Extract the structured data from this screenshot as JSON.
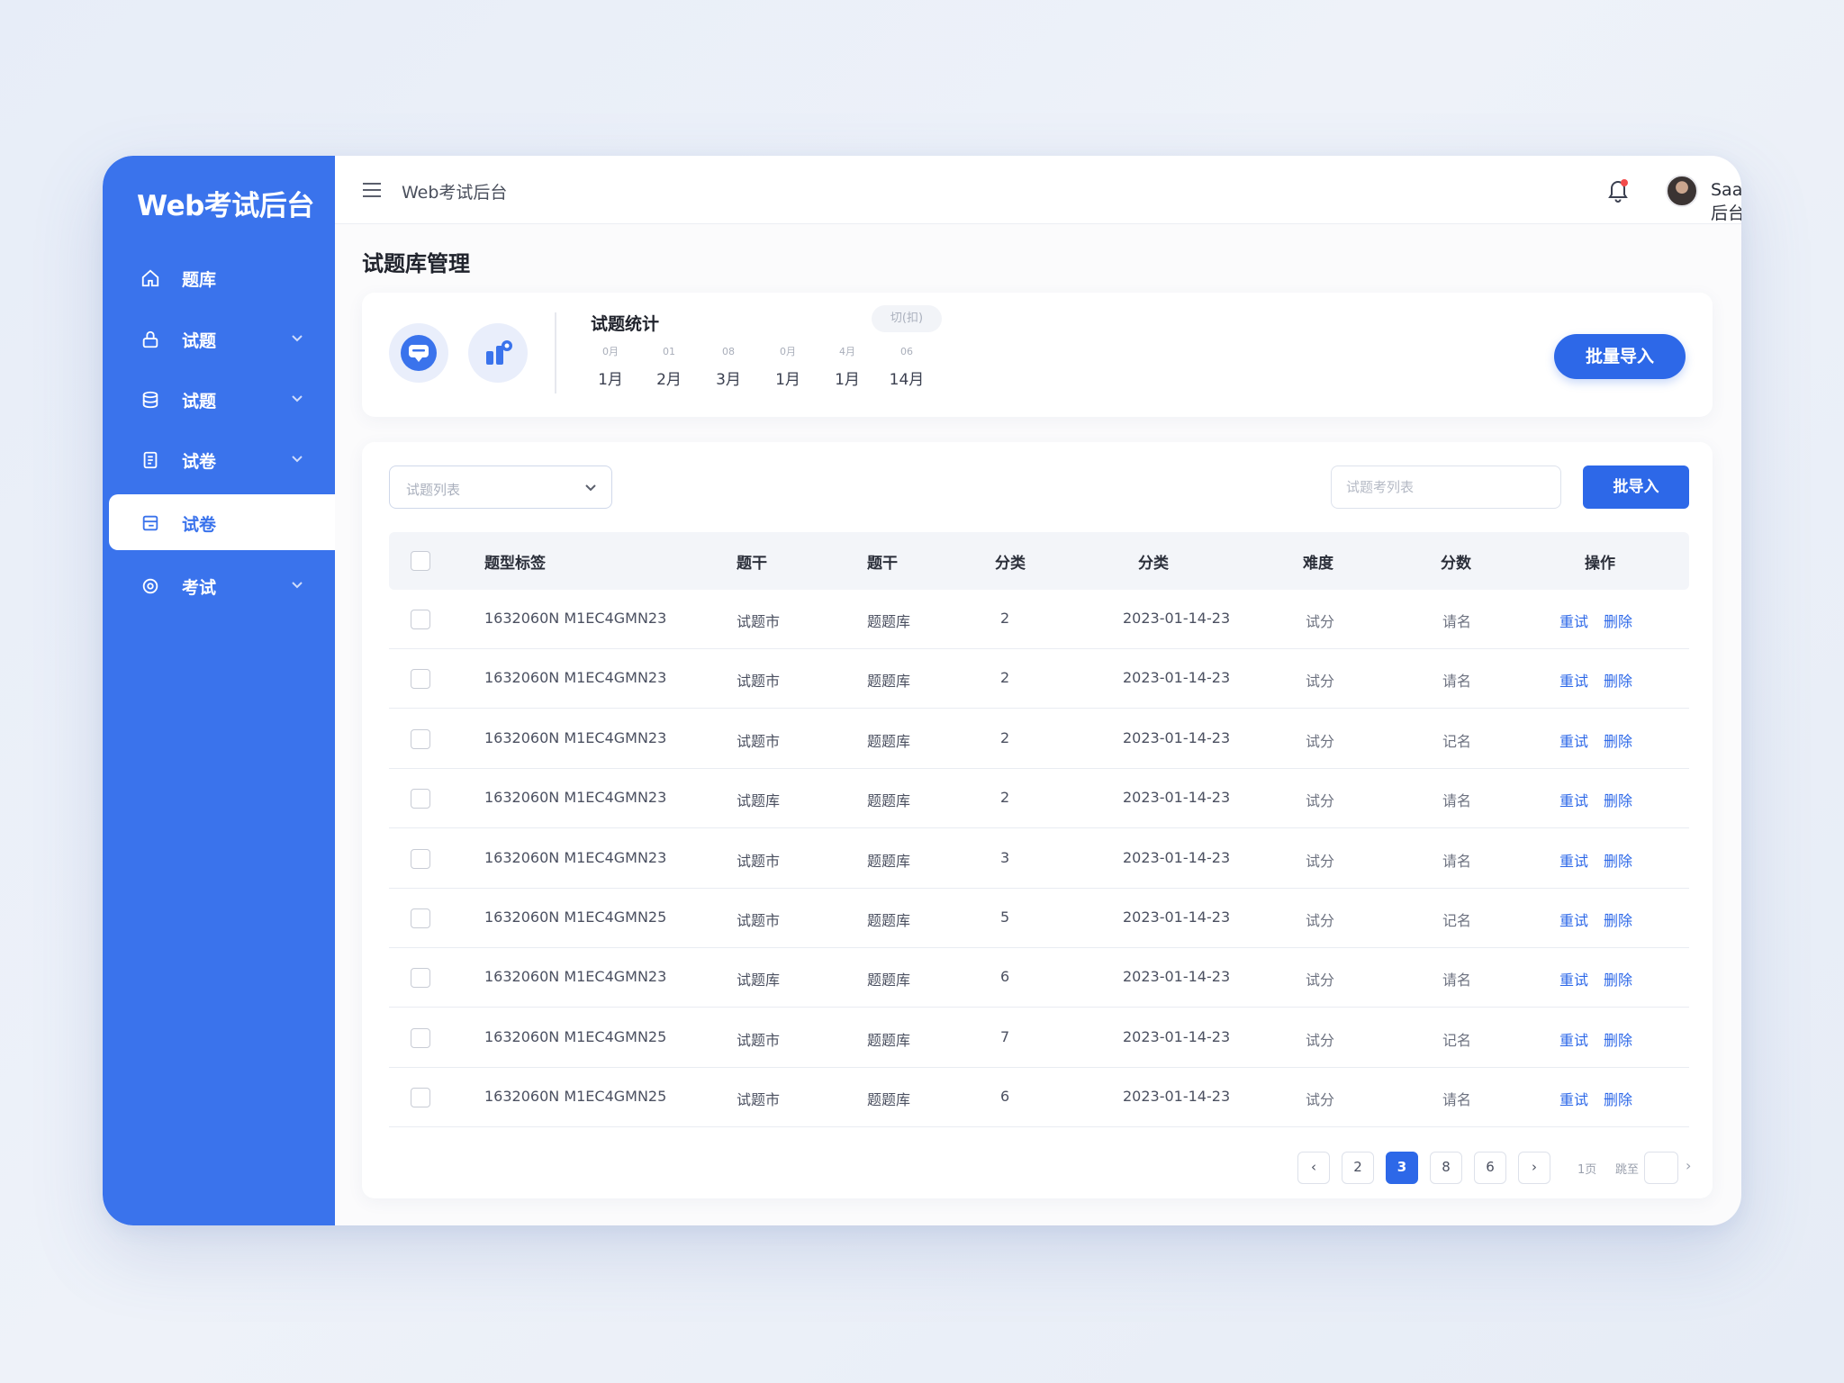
{
  "app": {
    "logo": "Web考试后台"
  },
  "sidebar": {
    "items": [
      {
        "label": "题库",
        "icon": "home-icon",
        "expandable": false,
        "active": false
      },
      {
        "label": "试题",
        "icon": "lock-icon",
        "expandable": true,
        "active": false
      },
      {
        "label": "试题",
        "icon": "database-icon",
        "expandable": true,
        "active": false
      },
      {
        "label": "试卷",
        "icon": "document-icon",
        "expandable": true,
        "active": false
      },
      {
        "label": "试卷",
        "icon": "paper-icon",
        "expandable": false,
        "active": true
      },
      {
        "label": "考试",
        "icon": "target-icon",
        "expandable": true,
        "active": false
      }
    ]
  },
  "topbar": {
    "title": "Web考试后台",
    "user_name": "SaaS后台"
  },
  "page": {
    "title": "试题库管理"
  },
  "stats": {
    "title": "试题统计",
    "pill": "切(扣)",
    "columns": [
      {
        "small": "0月",
        "big": "1月"
      },
      {
        "small": "01",
        "big": "2月"
      },
      {
        "small": "08",
        "big": "3月"
      },
      {
        "small": "0月",
        "big": "1月"
      },
      {
        "small": "4月",
        "big": "1月"
      },
      {
        "small": "06",
        "big": "14月"
      }
    ],
    "batch_button": "批量导入"
  },
  "toolbar": {
    "select_value": "试题列表",
    "search_placeholder": "试题考列表",
    "import_button": "批导入"
  },
  "table": {
    "headers": [
      "题型标签",
      "题干",
      "题干",
      "分类",
      "分类",
      "难度",
      "分数",
      "操作"
    ],
    "rows": [
      {
        "tag": "1632060N M1EC4GMN23",
        "stem1": "试题市",
        "stem2": "题题库",
        "cat": "2",
        "date": "2023-01-14-23",
        "difficulty": "试分",
        "score": "请名",
        "action1": "重试",
        "action2": "删除"
      },
      {
        "tag": "1632060N M1EC4GMN23",
        "stem1": "试题市",
        "stem2": "题题库",
        "cat": "2",
        "date": "2023-01-14-23",
        "difficulty": "试分",
        "score": "请名",
        "action1": "重试",
        "action2": "删除"
      },
      {
        "tag": "1632060N M1EC4GMN23",
        "stem1": "试题市",
        "stem2": "题题库",
        "cat": "2",
        "date": "2023-01-14-23",
        "difficulty": "试分",
        "score": "记名",
        "action1": "重试",
        "action2": "删除"
      },
      {
        "tag": "1632060N M1EC4GMN23",
        "stem1": "试题库",
        "stem2": "题题库",
        "cat": "2",
        "date": "2023-01-14-23",
        "difficulty": "试分",
        "score": "请名",
        "action1": "重试",
        "action2": "删除"
      },
      {
        "tag": "1632060N M1EC4GMN23",
        "stem1": "试题市",
        "stem2": "题题库",
        "cat": "3",
        "date": "2023-01-14-23",
        "difficulty": "试分",
        "score": "请名",
        "action1": "重试",
        "action2": "删除"
      },
      {
        "tag": "1632060N M1EC4GMN25",
        "stem1": "试题市",
        "stem2": "题题库",
        "cat": "5",
        "date": "2023-01-14-23",
        "difficulty": "试分",
        "score": "记名",
        "action1": "重试",
        "action2": "删除"
      },
      {
        "tag": "1632060N M1EC4GMN23",
        "stem1": "试题库",
        "stem2": "题题库",
        "cat": "6",
        "date": "2023-01-14-23",
        "difficulty": "试分",
        "score": "请名",
        "action1": "重试",
        "action2": "删除"
      },
      {
        "tag": "1632060N M1EC4GMN25",
        "stem1": "试题市",
        "stem2": "题题库",
        "cat": "7",
        "date": "2023-01-14-23",
        "difficulty": "试分",
        "score": "记名",
        "action1": "重试",
        "action2": "删除"
      },
      {
        "tag": "1632060N M1EC4GMN25",
        "stem1": "试题市",
        "stem2": "题题库",
        "cat": "6",
        "date": "2023-01-14-23",
        "difficulty": "试分",
        "score": "请名",
        "action1": "重试",
        "action2": "删除"
      }
    ]
  },
  "pagination": {
    "prev": "‹",
    "pages": [
      "2",
      "3",
      "8",
      "6"
    ],
    "active_page": "3",
    "next": "›",
    "total_text": "1页",
    "jump_text": "跳至",
    "jump_arrow": "›"
  },
  "colors": {
    "primary": "#2d68e8",
    "sidebar": "#3a73ec",
    "bell_dot": "#f24b4b"
  }
}
